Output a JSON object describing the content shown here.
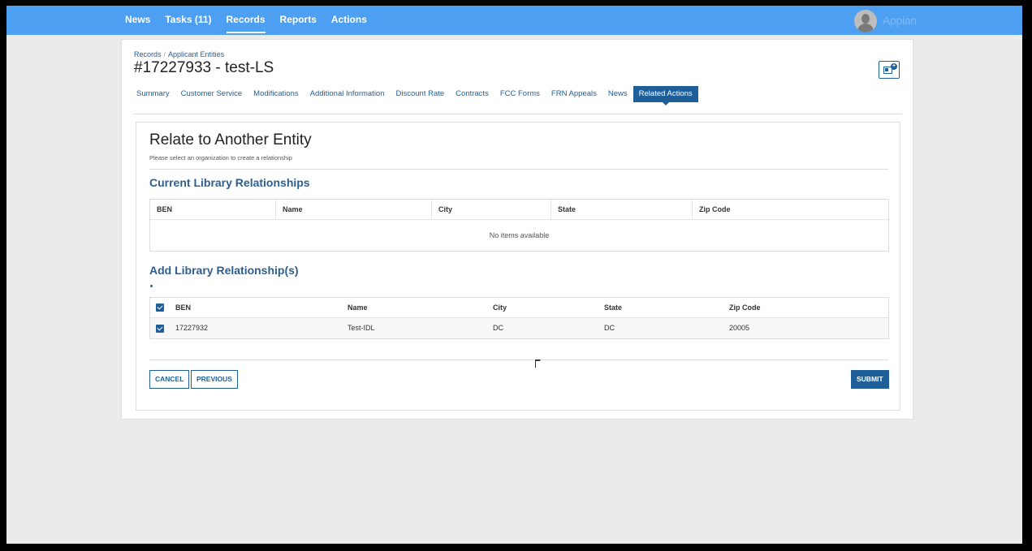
{
  "nav": {
    "items": [
      {
        "label": "News",
        "active": false
      },
      {
        "label": "Tasks (11)",
        "active": false
      },
      {
        "label": "Records",
        "active": true
      },
      {
        "label": "Reports",
        "active": false
      },
      {
        "label": "Actions",
        "active": false
      }
    ],
    "brand": "Appian",
    "bar_color": "#4d9ff2"
  },
  "record": {
    "breadcrumb": [
      "Records",
      "Applicant Entities"
    ],
    "title": "#17227933 - test-LS",
    "tabs": [
      {
        "label": "Summary",
        "active": false
      },
      {
        "label": "Customer Service",
        "active": false
      },
      {
        "label": "Modifications",
        "active": false
      },
      {
        "label": "Additional Information",
        "active": false
      },
      {
        "label": "Discount Rate",
        "active": false
      },
      {
        "label": "Contracts",
        "active": false
      },
      {
        "label": "FCC Forms",
        "active": false
      },
      {
        "label": "FRN Appeals",
        "active": false
      },
      {
        "label": "News",
        "active": false
      },
      {
        "label": "Related Actions",
        "active": true
      }
    ]
  },
  "form": {
    "title": "Relate to Another Entity",
    "subtitle": "Please select an organization to create a relationship",
    "current_section": {
      "title": "Current Library Relationships",
      "columns": [
        "BEN",
        "Name",
        "City",
        "State",
        "Zip Code"
      ],
      "empty_text": "No items available"
    },
    "add_section": {
      "title": "Add Library Relationship(s)",
      "columns": [
        "BEN",
        "Name",
        "City",
        "State",
        "Zip Code"
      ],
      "rows": [
        {
          "checked": true,
          "ben": "17227932",
          "name": "Test-IDL",
          "city": "DC",
          "state": "DC",
          "zip": "20005"
        }
      ]
    },
    "buttons": {
      "cancel": "CANCEL",
      "previous": "PREVIOUS",
      "submit": "SUBMIT"
    },
    "accent_color": "#1f5f99"
  }
}
